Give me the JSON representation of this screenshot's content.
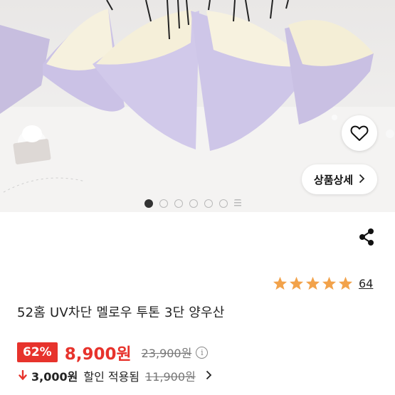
{
  "product_image": {
    "wishlist_icon": "heart-outline-icon",
    "detail_button_label": "상품상세",
    "detail_button_icon": "chevron-right-icon",
    "carousel": {
      "total": 7,
      "active_index": 0
    }
  },
  "share_icon": "share-icon",
  "rating": {
    "stars": 5,
    "star_color": "#f2a24a",
    "review_count": "64"
  },
  "product": {
    "title": "52홈 UV차단 멜로우 투톤 3단 양우산"
  },
  "price": {
    "discount_percent": "62%",
    "sale_price": "8,900원",
    "original_price": "23,900원",
    "info_icon": "info-circle-icon",
    "accent_color": "#e7332c"
  },
  "coupon": {
    "arrow_icon": "arrow-down-icon",
    "amount": "3,000원",
    "label": "할인 적용됨",
    "before_price": "11,900원",
    "chevron_icon": "chevron-right-icon"
  }
}
